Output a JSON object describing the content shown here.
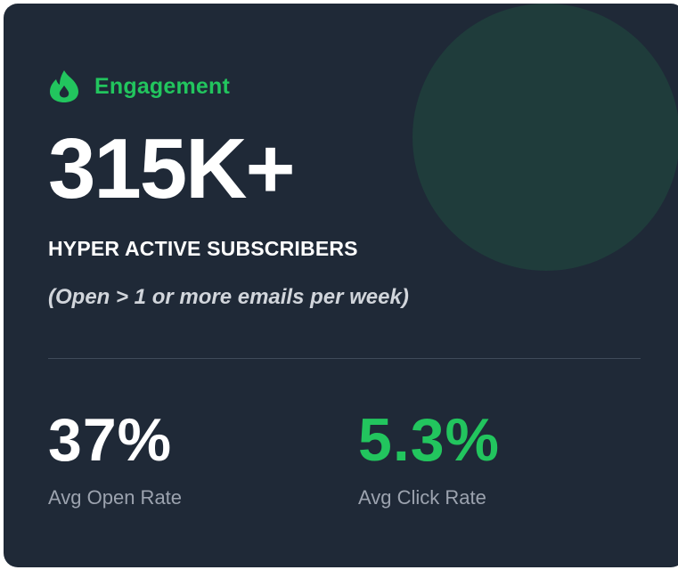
{
  "card": {
    "eyebrow": {
      "icon": "flame-icon",
      "label": "Engagement"
    },
    "headline_value": "315K+",
    "headline_label": "HYPER ACTIVE SUBSCRIBERS",
    "note": "(Open > 1 or more emails per week)",
    "stats": [
      {
        "value": "37%",
        "caption": "Avg Open Rate"
      },
      {
        "value": "5.3%",
        "caption": "Avg Click Rate"
      }
    ]
  },
  "colors": {
    "card_background": "#1f2937",
    "accent": "#22c55e",
    "primary_text": "#ffffff",
    "secondary_text": "#9ca3af",
    "note_text": "#d1d5db"
  }
}
